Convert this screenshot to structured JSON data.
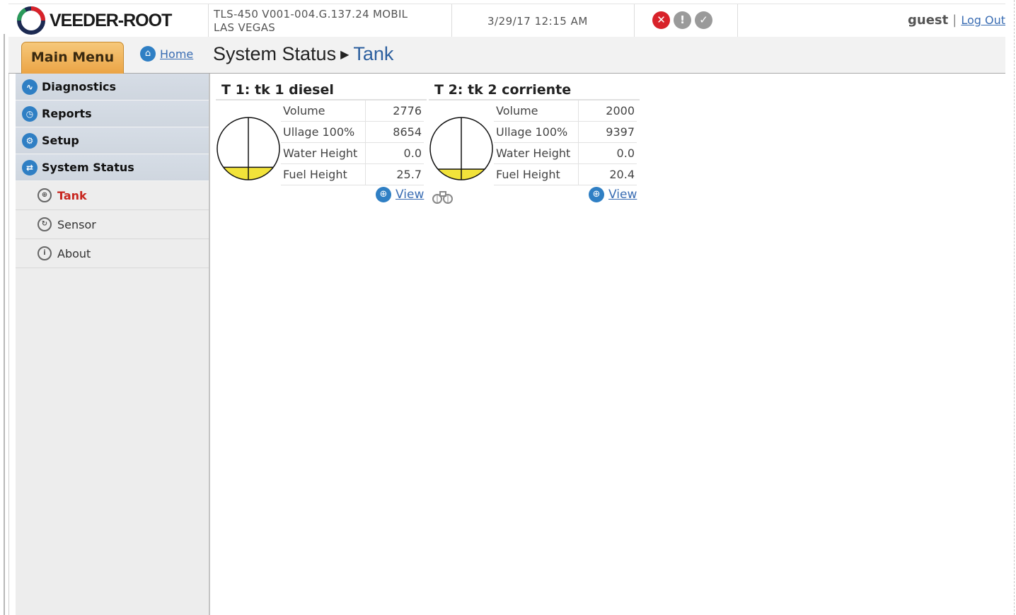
{
  "header": {
    "brand": "VEEDER-ROOT",
    "system_line1": "TLS-450 V001-004.G.137.24 MOBIL",
    "system_line2": "LAS VEGAS",
    "datetime": "3/29/17 12:15 AM",
    "alarm_icons": [
      "alarm-icon",
      "warning-icon",
      "ok-icon"
    ],
    "username": "guest",
    "logout_label": "Log Out"
  },
  "titlebar": {
    "main_menu_label": "Main Menu",
    "home_label": "Home",
    "breadcrumb_section": "System Status",
    "breadcrumb_current": "Tank"
  },
  "sidebar": {
    "categories": [
      {
        "label": "Diagnostics",
        "icon": "diagnostics-icon"
      },
      {
        "label": "Reports",
        "icon": "reports-icon"
      },
      {
        "label": "Setup",
        "icon": "setup-icon"
      },
      {
        "label": "System Status",
        "icon": "system-status-icon"
      }
    ],
    "subitems": [
      {
        "label": "Tank",
        "icon": "tank-icon",
        "active": true
      },
      {
        "label": "Sensor",
        "icon": "sensor-icon",
        "active": false
      },
      {
        "label": "About",
        "icon": "info-icon",
        "active": false
      }
    ]
  },
  "tanks": [
    {
      "title": "T 1: tk 1 diesel",
      "rows": [
        {
          "label": "Volume",
          "value": "2776"
        },
        {
          "label": "Ullage 100%",
          "value": "8654"
        },
        {
          "label": "Water Height",
          "value": "0.0"
        },
        {
          "label": "Fuel Height",
          "value": "25.7"
        }
      ],
      "fill_level": 0.2,
      "view_label": "View"
    },
    {
      "title": "T 2: tk 2 corriente",
      "rows": [
        {
          "label": "Volume",
          "value": "2000"
        },
        {
          "label": "Ullage 100%",
          "value": "9397"
        },
        {
          "label": "Water Height",
          "value": "0.0"
        },
        {
          "label": "Fuel Height",
          "value": "20.4"
        }
      ],
      "fill_level": 0.17,
      "view_label": "View"
    }
  ],
  "colors": {
    "fuel": "#f2e33a",
    "accent_blue": "#2f7fc4",
    "active_red": "#c8261f",
    "menu_orange": "#eba445"
  }
}
